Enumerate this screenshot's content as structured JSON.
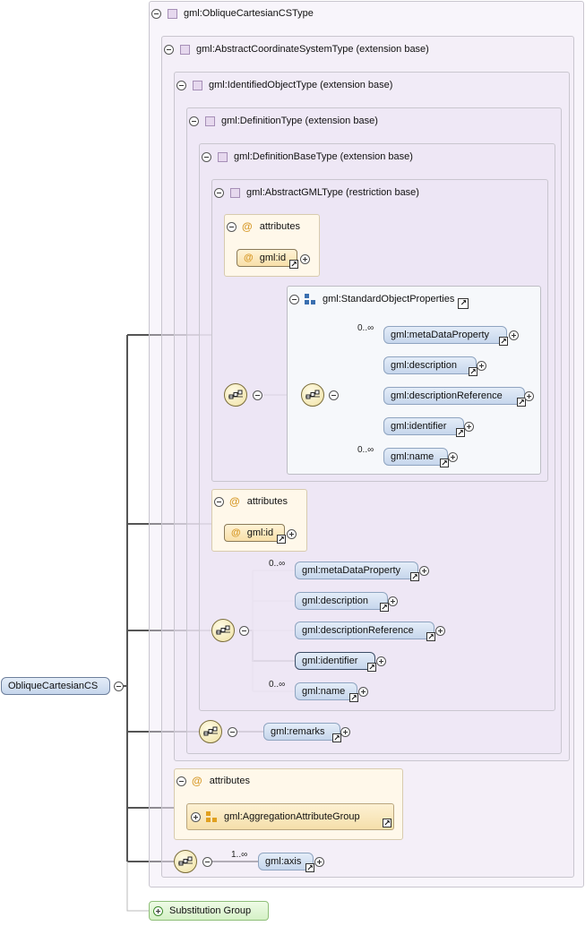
{
  "root": {
    "name": "ObliqueCartesianCS"
  },
  "types": {
    "oblique": "gml:ObliqueCartesianCSType",
    "abstract_cs": "gml:AbstractCoordinateSystemType (extension base)",
    "identified": "gml:IdentifiedObjectType (extension base)",
    "definition": "gml:DefinitionType (extension base)",
    "definition_base": "gml:DefinitionBaseType (extension base)",
    "abstract_gml": "gml:AbstractGMLType (restriction base)"
  },
  "attributes_label": "attributes",
  "attr_id": "gml:id",
  "standard_object_properties": {
    "title": "gml:StandardObjectProperties",
    "elements": [
      {
        "name": "gml:metaDataProperty",
        "card": "0..∞"
      },
      {
        "name": "gml:description",
        "card": ""
      },
      {
        "name": "gml:descriptionReference",
        "card": ""
      },
      {
        "name": "gml:identifier",
        "card": ""
      },
      {
        "name": "gml:name",
        "card": "0..∞"
      }
    ]
  },
  "definition_base_sequence": [
    {
      "name": "gml:metaDataProperty",
      "card": "0..∞"
    },
    {
      "name": "gml:description",
      "card": ""
    },
    {
      "name": "gml:descriptionReference",
      "card": ""
    },
    {
      "name": "gml:identifier",
      "card": ""
    },
    {
      "name": "gml:name",
      "card": "0..∞"
    }
  ],
  "remarks": "gml:remarks",
  "aggregation_group": "gml:AggregationAttributeGroup",
  "axis": {
    "name": "gml:axis",
    "card": "1..∞"
  },
  "substitution_group": "Substitution Group",
  "colors": {
    "element_fill": "#c6d6ec",
    "attr_fill": "#fff8ea",
    "type_fill": "#ece4f4",
    "subst_fill": "#d5f1c6"
  }
}
